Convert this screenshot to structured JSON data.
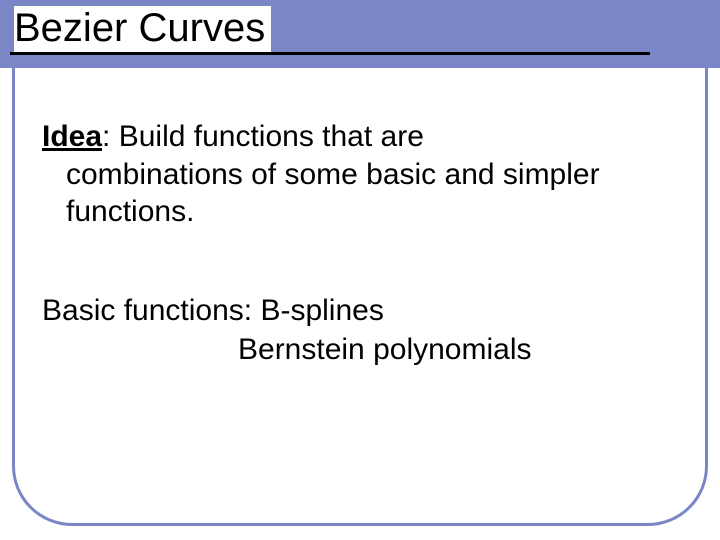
{
  "title": "Bezier Curves",
  "idea": {
    "label": "Idea",
    "sep": ": ",
    "line1_rest": "Build functions that are",
    "line2": "combinations of some basic and simpler",
    "line3": "functions."
  },
  "basic": {
    "line1": "Basic functions: B-splines",
    "line2": "Bernstein polynomials"
  }
}
